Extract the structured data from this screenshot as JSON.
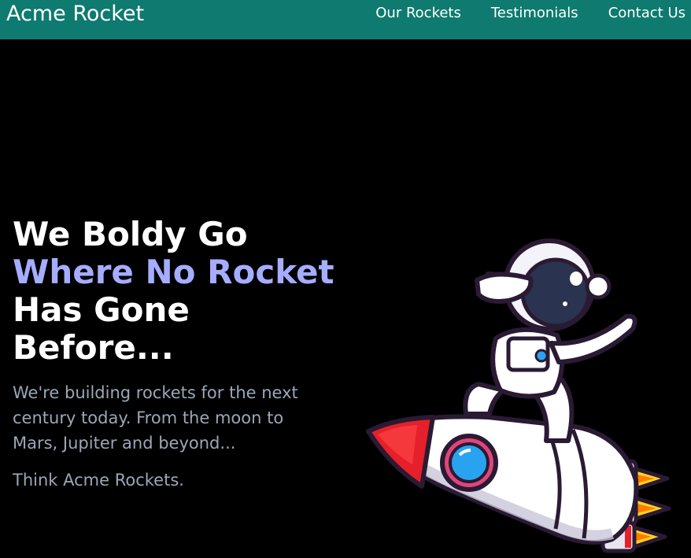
{
  "navbar": {
    "brand": "Acme Rocket",
    "links": [
      "Our Rockets",
      "Testimonials",
      "Contact Us"
    ],
    "background": "#0e7a70"
  },
  "hero": {
    "headline_line1": "We Boldy Go",
    "headline_accent": "Where No Rocket",
    "headline_line3": "Has Gone",
    "headline_line4": "Before...",
    "subtext": "We're building rockets for the next century today. From the moon to Mars, Jupiter and beyond...",
    "tagline": "Think Acme Rockets.",
    "accent_color": "#a5adff",
    "illustration": "astronaut-on-rocket"
  }
}
